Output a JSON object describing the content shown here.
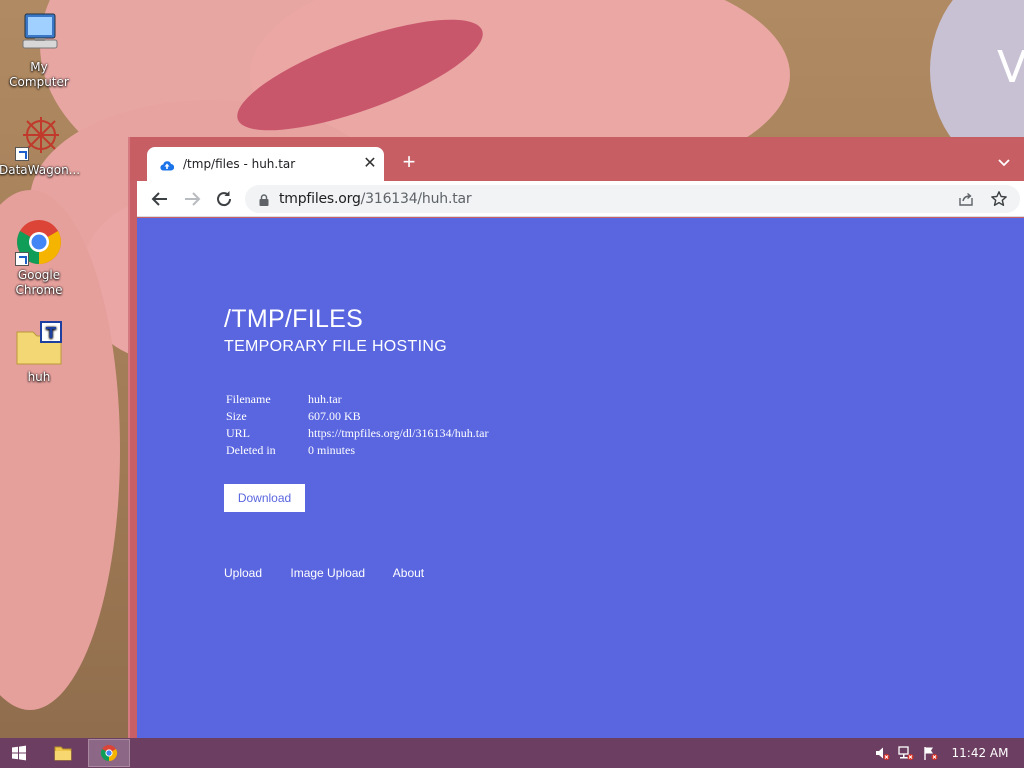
{
  "desktop": {
    "icons": [
      {
        "label": "My Computer",
        "icon": "computer-icon"
      },
      {
        "label": "DataWagon...",
        "icon": "datawagon-icon"
      },
      {
        "label": "Google Chrome",
        "icon": "chrome-icon"
      },
      {
        "label": "huh",
        "icon": "text-file-icon"
      }
    ],
    "wallpaper_partial_letter": "V"
  },
  "browser": {
    "tab": {
      "title": "/tmp/files - huh.tar",
      "icon": "cloud-upload-icon"
    },
    "new_tab_glyph": "+",
    "close_tab_glyph": "✕",
    "address": {
      "host": "tmpfiles.org",
      "path": "/316134/huh.tar"
    }
  },
  "page": {
    "title": "/TMP/FILES",
    "subtitle": "TEMPORARY FILE HOSTING",
    "info": [
      {
        "key": "Filename",
        "value": "huh.tar"
      },
      {
        "key": "Size",
        "value": "607.00 KB"
      },
      {
        "key": "URL",
        "value": "https://tmpfiles.org/dl/316134/huh.tar"
      },
      {
        "key": "Deleted in",
        "value": "0 minutes"
      }
    ],
    "download_label": "Download",
    "nav": [
      "Upload",
      "Image Upload",
      "About"
    ],
    "colors": {
      "background": "#5a66df",
      "text": "#ffffff"
    }
  },
  "taskbar": {
    "clock": "11:42 AM",
    "color": "#6c3f62"
  }
}
